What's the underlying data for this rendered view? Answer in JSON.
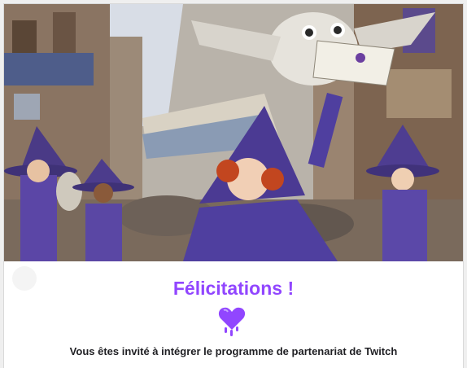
{
  "email": {
    "headline": "Félicitations !",
    "message": "Vous êtes invité à intégrer le programme de partenariat de Twitch"
  },
  "hero": {
    "image_subject": "illustration of witches in a medieval city with an owl carrying an envelope"
  },
  "icons": {
    "heart": "glitch-heart-icon"
  },
  "colors": {
    "brand_purple": "#9146ff",
    "text_dark": "#1f1f23",
    "background": "#efefef",
    "card": "#ffffff"
  }
}
